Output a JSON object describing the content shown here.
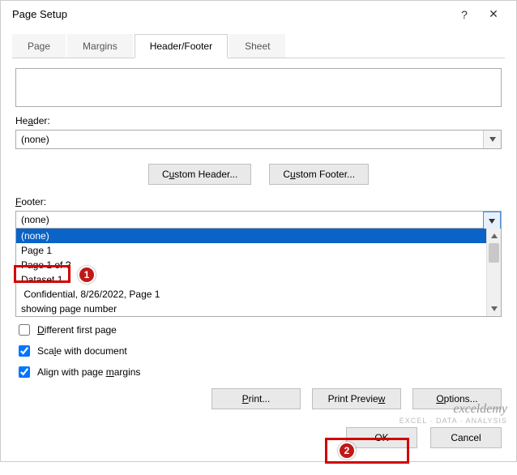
{
  "title": "Page Setup",
  "help_symbol": "?",
  "close_symbol": "✕",
  "tabs": {
    "page": "Page",
    "margins": "Margins",
    "hf": "Header/Footer",
    "sheet": "Sheet"
  },
  "header": {
    "label_pre": "He",
    "label_ul": "a",
    "label_post": "der:",
    "value": "(none)"
  },
  "custom_header": {
    "pre": "C",
    "ul": "u",
    "post": "stom Header..."
  },
  "custom_footer": {
    "pre": "C",
    "ul": "u",
    "post": "stom Footer..."
  },
  "footer": {
    "label_ul": "F",
    "label_post": "ooter:",
    "value": "(none)",
    "options": {
      "o0": "(none)",
      "o1": "Page 1",
      "o2": "Page 1 of ?",
      "o3": "Dataset 1",
      "o4": " Confidential, 8/26/2022, Page 1",
      "o5": "showing page number"
    }
  },
  "checks": {
    "diff": {
      "ul": "D",
      "post": "ifferent first page"
    },
    "scale": {
      "pre": "Sca",
      "ul": "l",
      "post": "e with document"
    },
    "align": {
      "pre": "Align with page ",
      "ul": "m",
      "post": "argins"
    }
  },
  "buttons": {
    "print": {
      "ul": "P",
      "post": "rint..."
    },
    "preview": {
      "pre": "Print Previe",
      "ul": "w"
    },
    "options": {
      "ul": "O",
      "post": "ptions..."
    },
    "ok": "OK",
    "cancel": "Cancel"
  },
  "watermark": {
    "line1": "exceldemy",
    "line2": "EXCEL · DATA · ANALYSIS"
  },
  "annotations": {
    "b1": "1",
    "b2": "2"
  }
}
